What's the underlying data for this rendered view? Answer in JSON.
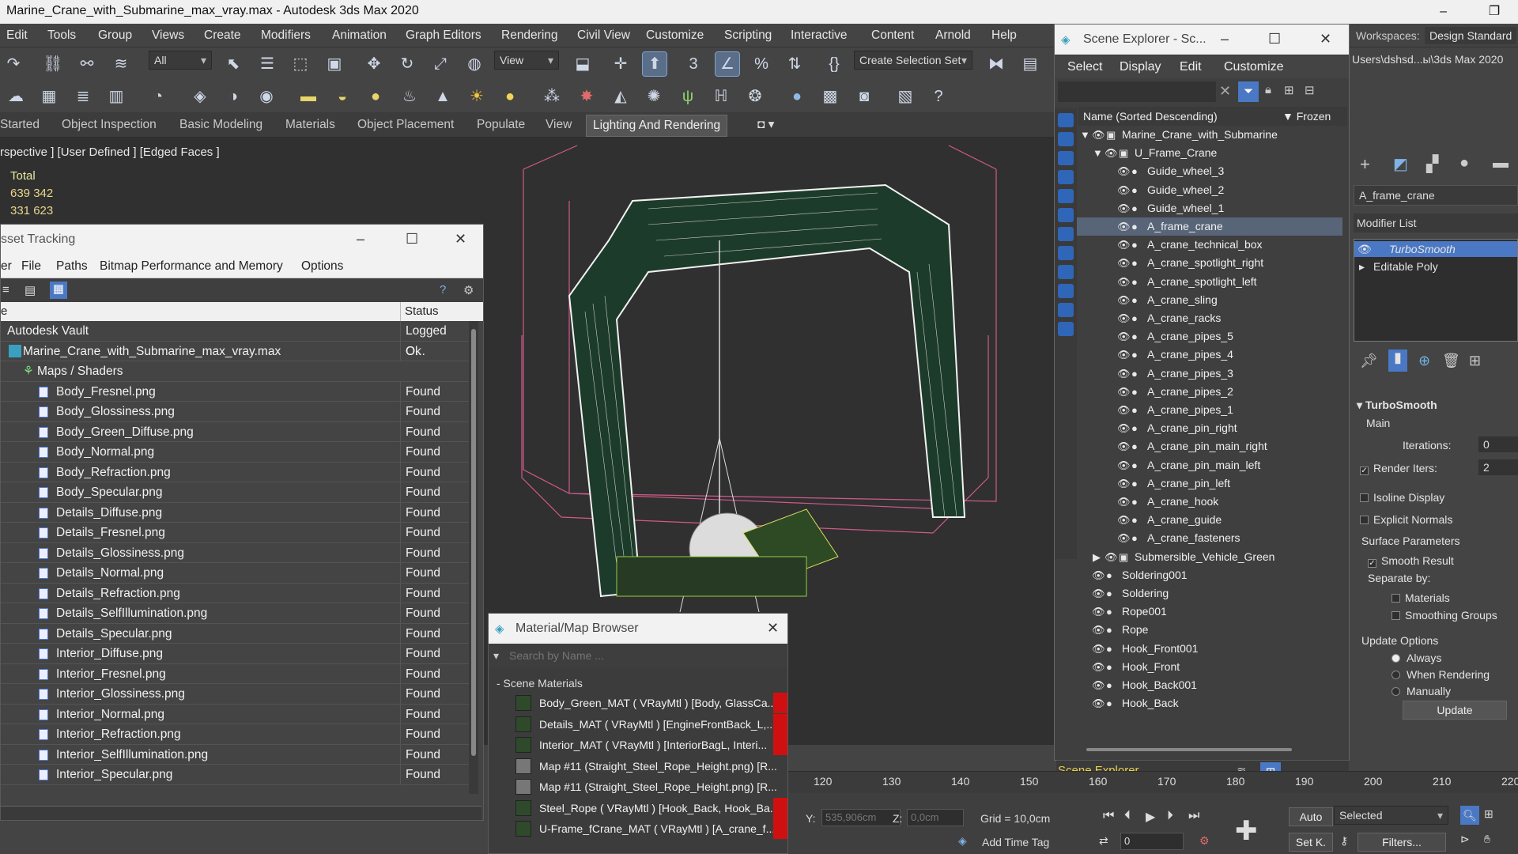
{
  "window": {
    "title": "Marine_Crane_with_Submarine_max_vray.max - Autodesk 3ds Max 2020",
    "minimize": "–",
    "restore": "❐"
  },
  "menu": [
    "Edit",
    "Tools",
    "Group",
    "Views",
    "Create",
    "Modifiers",
    "Animation",
    "Graph Editors",
    "Rendering",
    "Civil View",
    "Customize",
    "Scripting",
    "Interactive",
    "Content",
    "Arnold",
    "Help"
  ],
  "workspaces": {
    "label": "Workspaces:",
    "value": "Design Standard",
    "path": "Users\\dshsd...ы\\3ds Max 2020"
  },
  "toolbar": {
    "filter": "All",
    "refcoord": "View",
    "selset": "Create Selection Set"
  },
  "ribbon": {
    "tabs": [
      "Started",
      "Object Inspection",
      "Basic Modeling",
      "Materials",
      "Object Placement",
      "Populate",
      "View",
      "Lighting And Rendering"
    ],
    "active": "Lighting And Rendering"
  },
  "viewport": {
    "label": "rspective ] [User Defined ] [Edged Faces ]",
    "stats": {
      "label": "Total",
      "polys": "639 342",
      "verts": "331 623"
    }
  },
  "asset_tracking": {
    "title": "sset Tracking",
    "menu": [
      "er",
      "File",
      "Paths",
      "Bitmap Performance and Memory",
      "Options"
    ],
    "col_name": "e",
    "col_status": "Status",
    "rows": [
      {
        "name": "Autodesk Vault",
        "status": "Logged O...",
        "indent": 0
      },
      {
        "name": "Marine_Crane_with_Submarine_max_vray.max",
        "status": "Ok",
        "indent": 1
      },
      {
        "name": "Maps / Shaders",
        "status": "",
        "indent": 2
      },
      {
        "name": "Body_Fresnel.png",
        "status": "Found",
        "indent": 3
      },
      {
        "name": "Body_Glossiness.png",
        "status": "Found",
        "indent": 3
      },
      {
        "name": "Body_Green_Diffuse.png",
        "status": "Found",
        "indent": 3
      },
      {
        "name": "Body_Normal.png",
        "status": "Found",
        "indent": 3
      },
      {
        "name": "Body_Refraction.png",
        "status": "Found",
        "indent": 3
      },
      {
        "name": "Body_Specular.png",
        "status": "Found",
        "indent": 3
      },
      {
        "name": "Details_Diffuse.png",
        "status": "Found",
        "indent": 3
      },
      {
        "name": "Details_Fresnel.png",
        "status": "Found",
        "indent": 3
      },
      {
        "name": "Details_Glossiness.png",
        "status": "Found",
        "indent": 3
      },
      {
        "name": "Details_Normal.png",
        "status": "Found",
        "indent": 3
      },
      {
        "name": "Details_Refraction.png",
        "status": "Found",
        "indent": 3
      },
      {
        "name": "Details_SelfIllumination.png",
        "status": "Found",
        "indent": 3
      },
      {
        "name": "Details_Specular.png",
        "status": "Found",
        "indent": 3
      },
      {
        "name": "Interior_Diffuse.png",
        "status": "Found",
        "indent": 3
      },
      {
        "name": "Interior_Fresnel.png",
        "status": "Found",
        "indent": 3
      },
      {
        "name": "Interior_Glossiness.png",
        "status": "Found",
        "indent": 3
      },
      {
        "name": "Interior_Normal.png",
        "status": "Found",
        "indent": 3
      },
      {
        "name": "Interior_Refraction.png",
        "status": "Found",
        "indent": 3
      },
      {
        "name": "Interior_SelfIllumination.png",
        "status": "Found",
        "indent": 3
      },
      {
        "name": "Interior_Specular.png",
        "status": "Found",
        "indent": 3
      }
    ]
  },
  "material_browser": {
    "title": "Material/Map Browser",
    "search_placeholder": "Search by Name ...",
    "section": "- Scene Materials",
    "items": [
      "Body_Green_MAT  ( VRayMtl )  [Body, GlassCa...",
      "Details_MAT  ( VRayMtl )  [EngineFrontBack_L,...",
      "Interior_MAT  ( VRayMtl )  [InteriorBagL, Interi...",
      "Map #11  (Straight_Steel_Rope_Height.png)  [R...",
      "Map #11  (Straight_Steel_Rope_Height.png)  [R...",
      "Steel_Rope  ( VRayMtl )  [Hook_Back, Hook_Ba...",
      "U-Frame_fCrane_MAT  ( VRayMtl )  [A_crane_f..."
    ]
  },
  "scene_explorer": {
    "title": "Scene Explorer - Sc...",
    "menu": [
      "Select",
      "Display",
      "Edit",
      "Customize"
    ],
    "col_name": "Name (Sorted Descending)",
    "col_frozen": "▼ Frozen",
    "rows": [
      {
        "name": "Marine_Crane_with_Submarine",
        "level": 0,
        "expander": "▼"
      },
      {
        "name": "U_Frame_Crane",
        "level": 1,
        "expander": "▼"
      },
      {
        "name": "Guide_wheel_3",
        "level": 2,
        "expander": ""
      },
      {
        "name": "Guide_wheel_2",
        "level": 2,
        "expander": ""
      },
      {
        "name": "Guide_wheel_1",
        "level": 2,
        "expander": ""
      },
      {
        "name": "A_frame_crane",
        "level": 2,
        "expander": "",
        "selected": true
      },
      {
        "name": "A_crane_technical_box",
        "level": 2,
        "expander": ""
      },
      {
        "name": "A_crane_spotlight_right",
        "level": 2,
        "expander": ""
      },
      {
        "name": "A_crane_spotlight_left",
        "level": 2,
        "expander": ""
      },
      {
        "name": "A_crane_sling",
        "level": 2,
        "expander": ""
      },
      {
        "name": "A_crane_racks",
        "level": 2,
        "expander": ""
      },
      {
        "name": "A_crane_pipes_5",
        "level": 2,
        "expander": ""
      },
      {
        "name": "A_crane_pipes_4",
        "level": 2,
        "expander": ""
      },
      {
        "name": "A_crane_pipes_3",
        "level": 2,
        "expander": ""
      },
      {
        "name": "A_crane_pipes_2",
        "level": 2,
        "expander": ""
      },
      {
        "name": "A_crane_pipes_1",
        "level": 2,
        "expander": ""
      },
      {
        "name": "A_crane_pin_right",
        "level": 2,
        "expander": ""
      },
      {
        "name": "A_crane_pin_main_right",
        "level": 2,
        "expander": ""
      },
      {
        "name": "A_crane_pin_main_left",
        "level": 2,
        "expander": ""
      },
      {
        "name": "A_crane_pin_left",
        "level": 2,
        "expander": ""
      },
      {
        "name": "A_crane_hook",
        "level": 2,
        "expander": ""
      },
      {
        "name": "A_crane_guide",
        "level": 2,
        "expander": ""
      },
      {
        "name": "A_crane_fasteners",
        "level": 2,
        "expander": ""
      },
      {
        "name": "Submersible_Vehicle_Green",
        "level": 1,
        "expander": "▶"
      },
      {
        "name": "Soldering001",
        "level": 0,
        "expander": ""
      },
      {
        "name": "Soldering",
        "level": 0,
        "expander": ""
      },
      {
        "name": "Rope001",
        "level": 0,
        "expander": ""
      },
      {
        "name": "Rope",
        "level": 0,
        "expander": ""
      },
      {
        "name": "Hook_Front001",
        "level": 0,
        "expander": ""
      },
      {
        "name": "Hook_Front",
        "level": 0,
        "expander": ""
      },
      {
        "name": "Hook_Back001",
        "level": 0,
        "expander": ""
      },
      {
        "name": "Hook_Back",
        "level": 0,
        "expander": ""
      }
    ],
    "bottom_label": "Scene Explorer"
  },
  "command_panel": {
    "object_name": "A_frame_crane",
    "modifier_list": "Modifier List",
    "stack": [
      "TurboSmooth",
      "Editable Poly"
    ],
    "rollout": "TurboSmooth",
    "main": "Main",
    "iterations_label": "Iterations:",
    "iterations": "0",
    "render_iters_label": "Render Iters:",
    "render_iters": "2",
    "isoline": "Isoline Display",
    "explicit": "Explicit Normals",
    "surface": "Surface Parameters",
    "smooth": "Smooth Result",
    "separate": "Separate by:",
    "materials": "Materials",
    "smoothing": "Smoothing Groups",
    "update_options": "Update Options",
    "always": "Always",
    "when_rendering": "When Rendering",
    "manually": "Manually",
    "update_btn": "Update"
  },
  "timeline": {
    "ticks": [
      "120",
      "130",
      "140",
      "150",
      "160",
      "170",
      "180",
      "190",
      "200",
      "210",
      "220"
    ]
  },
  "status": {
    "y_label": "Y:",
    "y": "535,906cm",
    "z_label": "Z:",
    "z": "0,0cm",
    "grid": "Grid = 10,0cm",
    "auto": "Auto",
    "selected": "Selected",
    "setk": "Set K.",
    "filters": "Filters...",
    "add_time_tag": "Add Time Tag",
    "frame": "0"
  }
}
